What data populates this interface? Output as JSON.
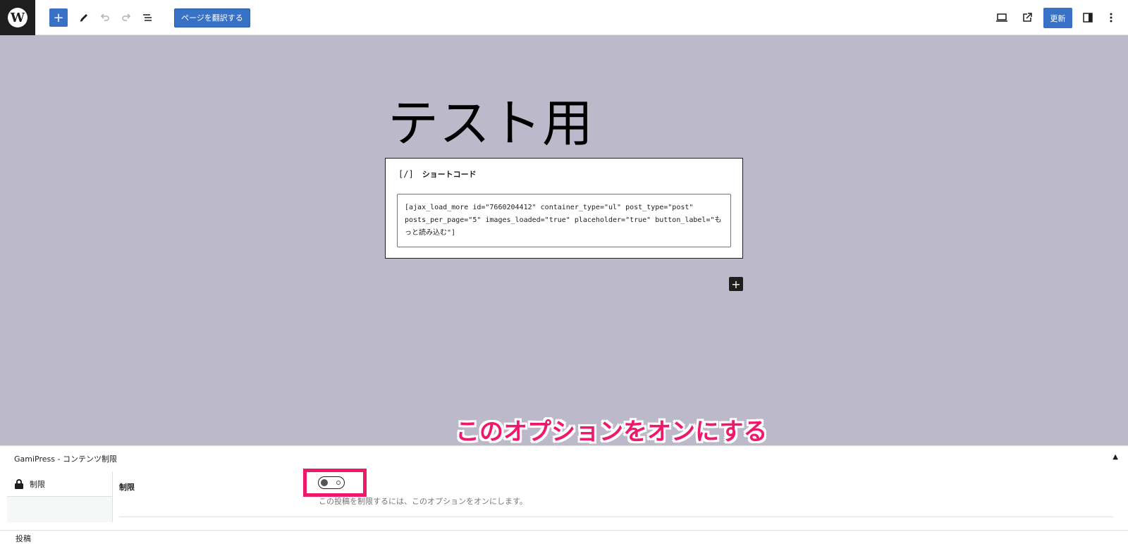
{
  "toolbar": {
    "translate_label": "ページを翻訳する",
    "update_label": "更新",
    "icons": {
      "logo": "wordpress-logo",
      "add": "plus-icon",
      "tools": "pencil-icon",
      "undo": "undo-icon",
      "redo": "redo-icon",
      "list_view": "list-view-icon",
      "view": "laptop-icon",
      "preview": "external-link-icon",
      "settings": "sidebar-icon",
      "options": "more-vertical-icon"
    }
  },
  "canvas": {
    "background": "#bcb9cb",
    "page_title": "テスト用",
    "shortcode_block": {
      "icon_text": "[/]",
      "label": "ショートコード",
      "content": "[ajax_load_more id=\"7660204412\" container_type=\"ul\" post_type=\"post\" posts_per_page=\"5\" images_loaded=\"true\" placeholder=\"true\" button_label=\"もっと読み込む\"]"
    }
  },
  "annotation": {
    "text": "このオプションをオンにする",
    "color": "#f0186a"
  },
  "metabox": {
    "title": "GamiPress - コンテンツ制限",
    "tab_label": "制限",
    "field_label": "制限",
    "toggle_on": false,
    "description": "この投稿を制限するには、このオプションをオンにします。"
  },
  "footer": {
    "label": "投稿"
  },
  "colors": {
    "accent": "#3871c5"
  }
}
